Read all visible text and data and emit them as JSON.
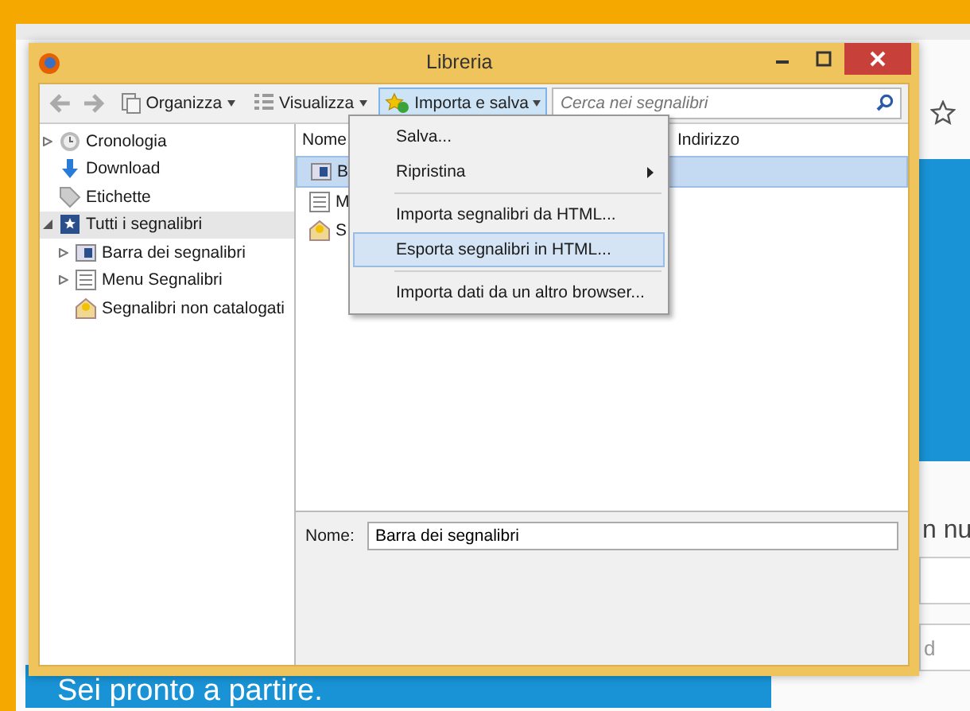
{
  "background": {
    "headline": "Sei pronto a partire.",
    "fragment_1": "n nu",
    "fragment_2": "d"
  },
  "window": {
    "title": "Libreria"
  },
  "toolbar": {
    "buttons": [
      {
        "label": "Organizza",
        "kind": "organize",
        "selected": false
      },
      {
        "label": "Visualizza",
        "kind": "view",
        "selected": false
      },
      {
        "label": "Importa e salva",
        "kind": "import",
        "selected": true
      }
    ],
    "search": {
      "placeholder": "Cerca nei segnalibri"
    }
  },
  "sidebar": {
    "items": [
      {
        "label": "Cronologia",
        "kind": "history",
        "expanded": false,
        "selected": false
      },
      {
        "label": "Download",
        "kind": "download",
        "selected": false
      },
      {
        "label": "Etichette",
        "kind": "tag",
        "selected": false
      },
      {
        "label": "Tutti i segnalibri",
        "kind": "star",
        "expanded": true,
        "selected": true,
        "children": [
          {
            "label": "Barra dei segnalibri",
            "kind": "toolbar",
            "expanded": false,
            "selected": false
          },
          {
            "label": "Menu Segnalibri",
            "kind": "menu",
            "expanded": false,
            "selected": false
          },
          {
            "label": "Segnalibri non catalogati",
            "kind": "unsorted",
            "selected": false
          }
        ]
      }
    ]
  },
  "table": {
    "columns": [
      "Nome",
      "Indirizzo"
    ],
    "rows": [
      {
        "name": "B",
        "kind": "toolbar",
        "selected": true
      },
      {
        "name": "M",
        "kind": "menu",
        "selected": false
      },
      {
        "name": "S",
        "kind": "unsorted",
        "selected": false
      }
    ]
  },
  "menu": {
    "groups": [
      {
        "items": [
          {
            "label": "Salva...",
            "submenu": false,
            "selected": false
          },
          {
            "label": "Ripristina",
            "submenu": true,
            "selected": false
          }
        ]
      },
      {
        "items": [
          {
            "label": "Importa segnalibri da HTML...",
            "submenu": false,
            "selected": false
          },
          {
            "label": "Esporta segnalibri in HTML...",
            "submenu": false,
            "selected": true
          }
        ]
      },
      {
        "items": [
          {
            "label": "Importa dati da un altro browser...",
            "submenu": false,
            "selected": false
          }
        ]
      }
    ]
  },
  "details": {
    "label": "Nome:",
    "value": "Barra dei segnalibri"
  }
}
